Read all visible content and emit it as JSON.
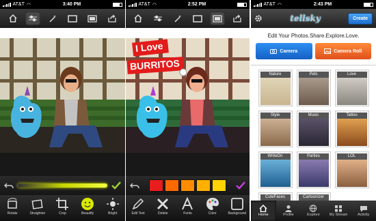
{
  "phone1": {
    "status": {
      "carrier": "AT&T",
      "time": "3:40 PM"
    },
    "tools": [
      {
        "label": "Rotate",
        "icon": "rotate-icon"
      },
      {
        "label": "Straighten",
        "icon": "straighten-icon"
      },
      {
        "label": "Crop",
        "icon": "crop-icon"
      },
      {
        "label": "Beautify",
        "icon": "beautify-icon"
      },
      {
        "label": "Bright",
        "icon": "brightness-icon"
      }
    ]
  },
  "phone2": {
    "status": {
      "carrier": "AT&T",
      "time": "2:52 PM"
    },
    "sticker": {
      "line1": "I Love",
      "line2": "BURRITOS"
    },
    "swatch_colors": [
      "#e81e1e",
      "#ff6a00",
      "#ff8c00",
      "#ffb000",
      "#ffd200"
    ],
    "tools": [
      {
        "label": "Edit Text",
        "icon": "edit-text-icon"
      },
      {
        "label": "Delete",
        "icon": "delete-icon"
      },
      {
        "label": "Fonts",
        "icon": "fonts-icon"
      },
      {
        "label": "Color",
        "icon": "color-palette-icon"
      },
      {
        "label": "Background",
        "icon": "background-icon"
      }
    ]
  },
  "phone3": {
    "status": {
      "carrier": "AT&T",
      "time": "2:43 PM"
    },
    "logo": "tellsky",
    "create_label": "Create",
    "tagline": "Edit Your Photos.Share.Explore.Love.",
    "camera_label": "Camera",
    "camera_roll_label": "Camera Roll",
    "categories": [
      {
        "label": "Nature",
        "color": "#c9b58f"
      },
      {
        "label": "Pets",
        "color": "#8d7c6e"
      },
      {
        "label": "Love",
        "color": "#b5b0a8"
      },
      {
        "label": "Style",
        "color": "#b89a7a"
      },
      {
        "label": "Music",
        "color": "#3f3a46"
      },
      {
        "label": "Tattoo",
        "color": "#b8772d"
      },
      {
        "label": "WriteOn",
        "color": "#2f7fb0"
      },
      {
        "label": "Parties",
        "color": "#5a5a8a"
      },
      {
        "label": "LOL",
        "color": "#b88a66"
      },
      {
        "label": "CuteFaces",
        "color": "#9a8a80"
      },
      {
        "label": "Cartoonizer",
        "color": "#2a9aa0"
      }
    ],
    "tabs": [
      {
        "label": "Home",
        "icon": "home-icon"
      },
      {
        "label": "Profile",
        "icon": "profile-icon"
      },
      {
        "label": "Explore",
        "icon": "globe-icon"
      },
      {
        "label": "My Stream",
        "icon": "stream-icon"
      },
      {
        "label": "Activity",
        "icon": "activity-icon"
      }
    ]
  },
  "colors": {
    "accent_yellow": "#d8e800",
    "checkmark_green": "#9acd32",
    "checkmark_purple": "#c03cd8"
  }
}
